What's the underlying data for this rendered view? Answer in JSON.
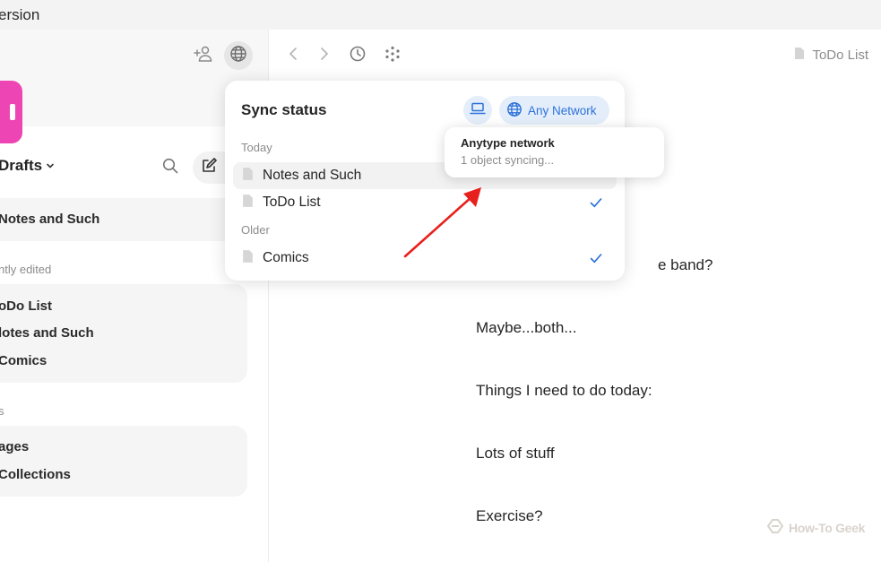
{
  "window": {
    "title": "ersion"
  },
  "sidebar": {
    "space_name": "Drafts",
    "pinned": [
      {
        "label": "Notes and Such"
      }
    ],
    "recent_label": "ntly edited",
    "recent": [
      {
        "label": "oDo List"
      },
      {
        "label": "lotes and Such"
      },
      {
        "label": "Comics"
      }
    ],
    "types_label": "s",
    "types": [
      {
        "label": "ages"
      },
      {
        "label": "Collections"
      }
    ]
  },
  "header": {
    "breadcrumb": "ToDo List"
  },
  "editor": {
    "paragraphs": [
      "e band?",
      "Maybe...both...",
      "Things I need to do today:",
      "Lots of stuff",
      "Exercise?"
    ]
  },
  "sync_popup": {
    "title": "Sync status",
    "network_label": "Any Network",
    "today_label": "Today",
    "older_label": "Older",
    "today_items": [
      {
        "label": "Notes and Such"
      },
      {
        "label": "ToDo List"
      }
    ],
    "older_items": [
      {
        "label": "Comics"
      }
    ]
  },
  "tooltip": {
    "title": "Anytype network",
    "status": "1 object syncing..."
  },
  "watermark": "How-To Geek",
  "colors": {
    "accent": "#2c71d9",
    "space_logo": "#ee45b5",
    "arrow": "#e8201d"
  },
  "icons": [
    "add-member-icon",
    "globe-icon",
    "chevron-down-icon",
    "search-icon",
    "edit-icon",
    "back-icon",
    "forward-icon",
    "history-icon",
    "graph-icon",
    "document-icon",
    "laptop-icon",
    "check-icon"
  ]
}
